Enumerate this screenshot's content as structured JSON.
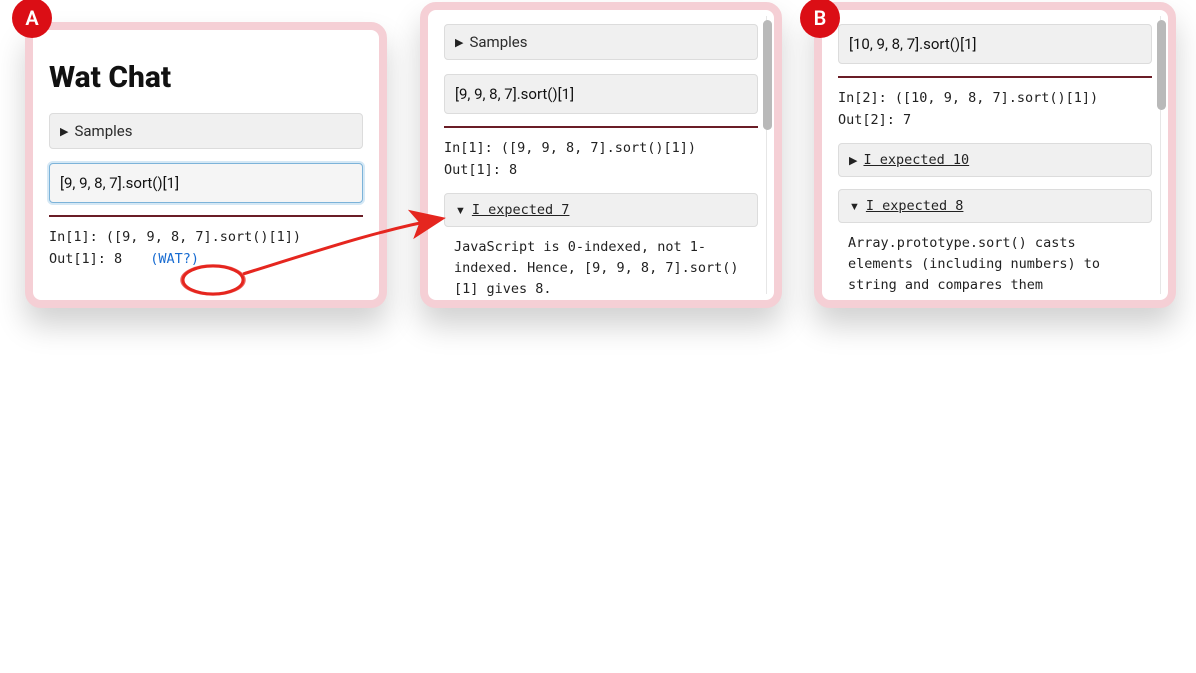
{
  "badges": {
    "A": "A",
    "B": "B"
  },
  "panel_a": {
    "title": "Wat Chat",
    "samples_label": "Samples",
    "input_value": "[9, 9, 8, 7].sort()[1]",
    "repl_in_label": "In[1]:",
    "repl_in_expr": "([9, 9, 8, 7].sort()[1])",
    "repl_out_label": "Out[1]:",
    "repl_out_value": "8",
    "wat_label": "(WAT?)"
  },
  "panel_b": {
    "samples_label": "Samples",
    "input_value": "[9, 9, 8, 7].sort()[1]",
    "repl_in_label": "In[1]:",
    "repl_in_expr": "([9, 9, 8, 7].sort()[1])",
    "repl_out_label": "Out[1]:",
    "repl_out_value": "8",
    "expected_label": "I expected 7",
    "explanation": "JavaScript is 0-indexed, not 1-indexed. Hence, [9, 9, 8, 7].sort()[1] gives 8."
  },
  "panel_c": {
    "input_value": "[10, 9, 8, 7].sort()[1]",
    "repl_in_label": "In[2]:",
    "repl_in_expr": "([10, 9, 8, 7].sort()[1])",
    "repl_out_label": "Out[2]:",
    "repl_out_value": "7",
    "expected_collapsed_label": "I expected 10",
    "expected_open_label": "I expected 8",
    "explanation": "Array.prototype.sort() casts elements (including numbers) to string and compares them lexicographically. If"
  },
  "colors": {
    "badge": "#db0e15",
    "border": "#f5cfd5",
    "rule": "#6a1d26",
    "link": "#176bd1",
    "annotation": "#e5261f"
  }
}
